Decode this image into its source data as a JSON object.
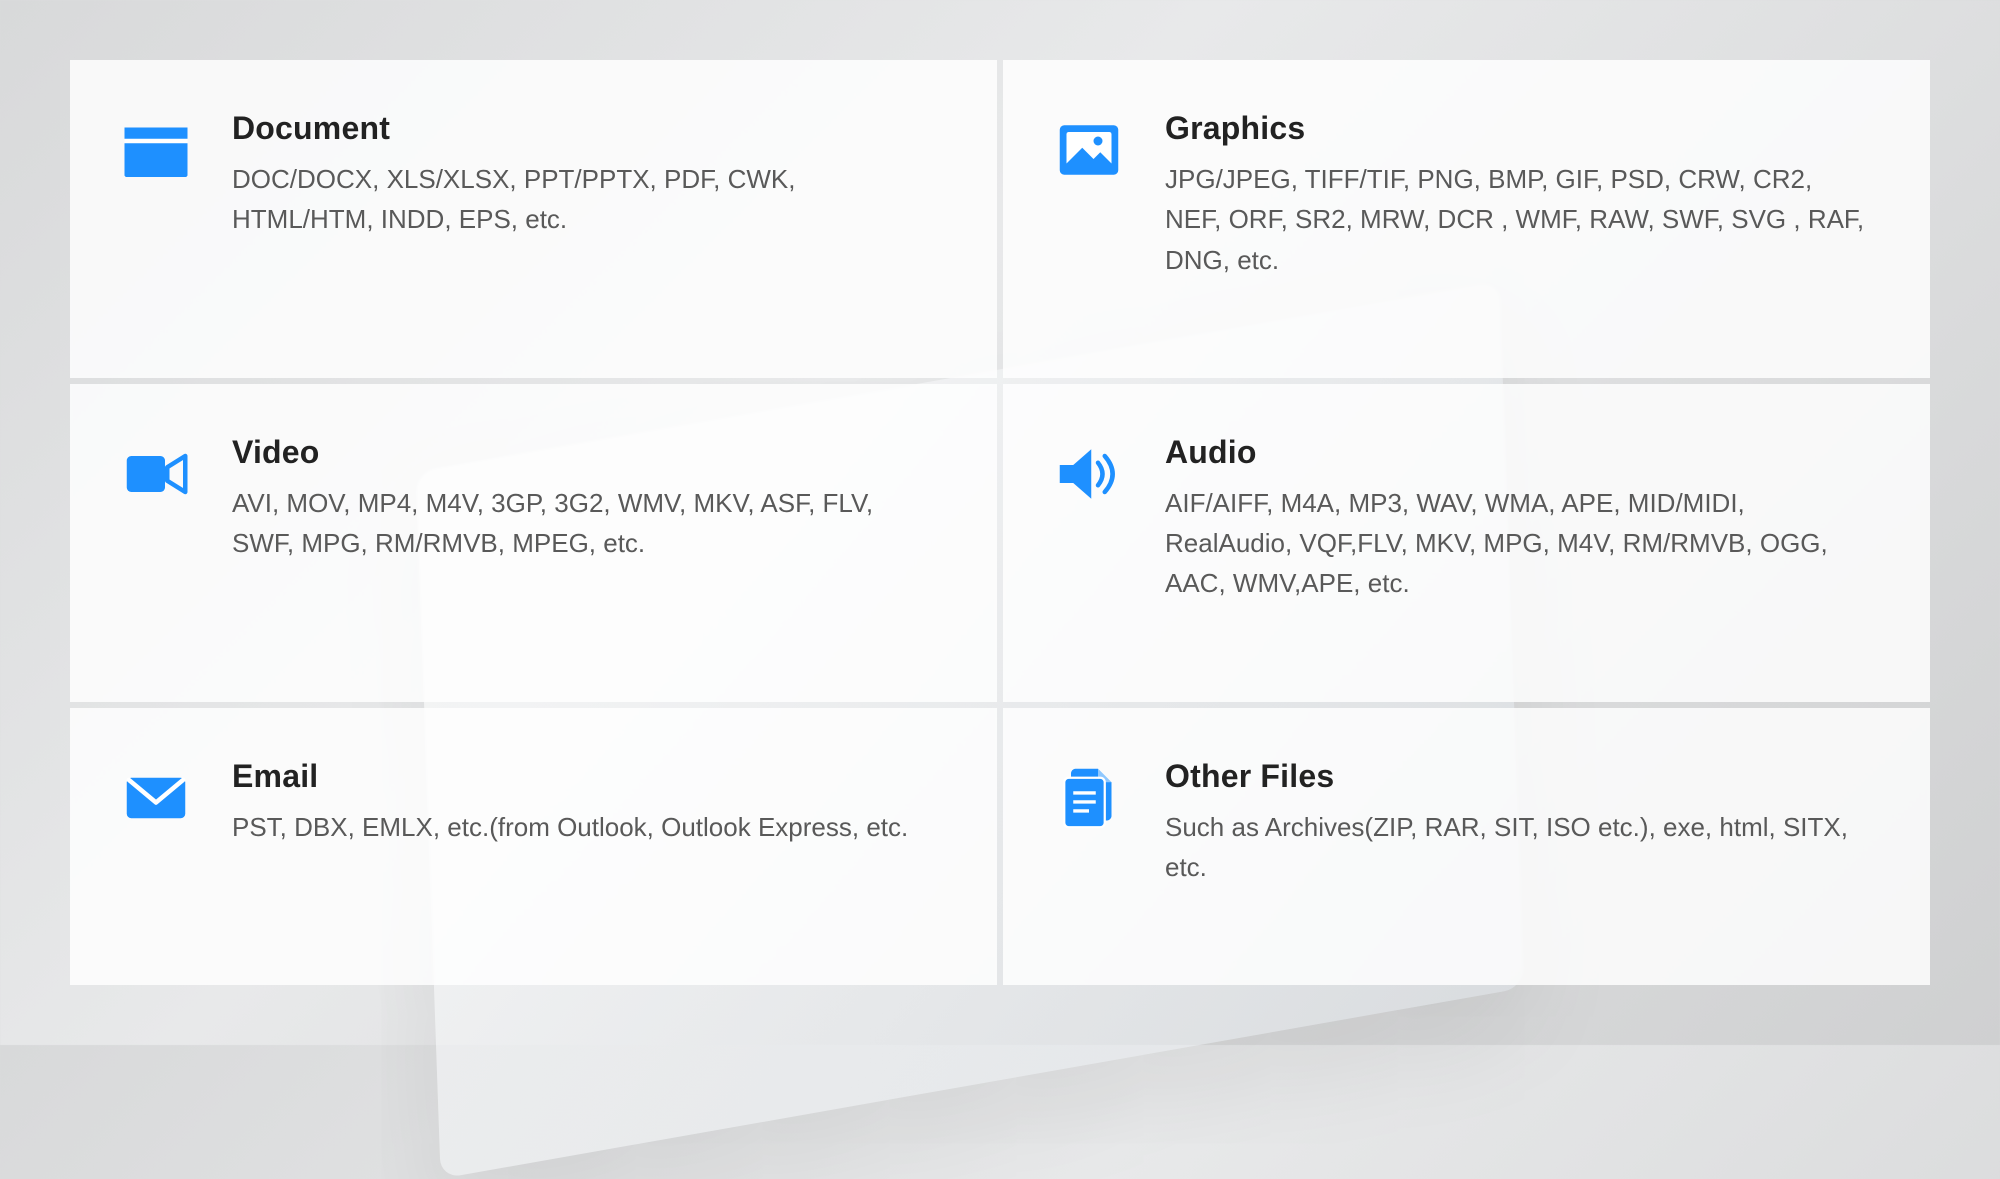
{
  "accent": "#1E90FF",
  "cards": [
    {
      "icon": "folder-icon",
      "title": "Document",
      "desc": "DOC/DOCX, XLS/XLSX, PPT/PPTX, PDF, CWK, HTML/HTM, INDD, EPS, etc."
    },
    {
      "icon": "image-icon",
      "title": "Graphics",
      "desc": "JPG/JPEG, TIFF/TIF, PNG, BMP, GIF, PSD, CRW, CR2, NEF, ORF, SR2, MRW, DCR , WMF, RAW, SWF, SVG , RAF, DNG, etc."
    },
    {
      "icon": "video-icon",
      "title": "Video",
      "desc": "AVI, MOV, MP4, M4V, 3GP, 3G2, WMV, MKV, ASF, FLV, SWF, MPG, RM/RMVB, MPEG, etc."
    },
    {
      "icon": "audio-icon",
      "title": "Audio",
      "desc": "AIF/AIFF, M4A, MP3, WAV, WMA, APE, MID/MIDI, RealAudio, VQF,FLV, MKV, MPG, M4V, RM/RMVB, OGG, AAC, WMV,APE, etc."
    },
    {
      "icon": "email-icon",
      "title": "Email",
      "desc": "PST, DBX, EMLX, etc.(from Outlook, Outlook Express, etc."
    },
    {
      "icon": "files-icon",
      "title": "Other Files",
      "desc": "Such as Archives(ZIP, RAR, SIT, ISO etc.), exe, html, SITX, etc."
    }
  ]
}
